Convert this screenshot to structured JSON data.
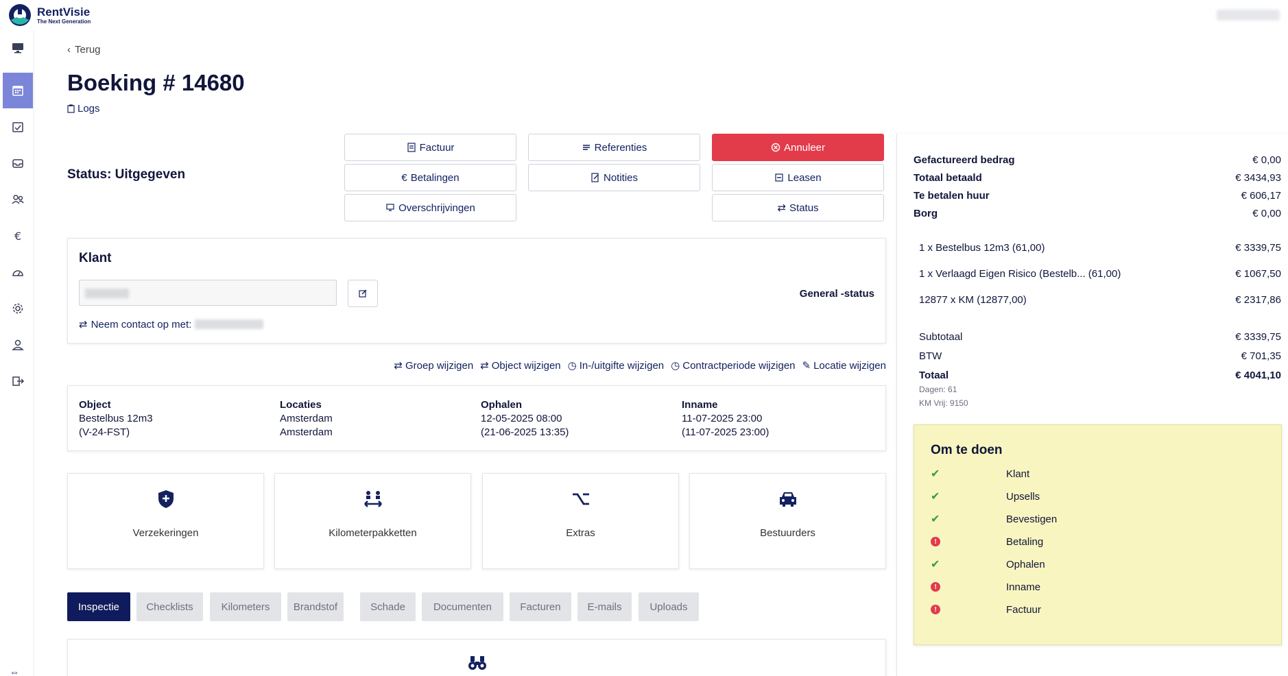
{
  "brand": {
    "name": "RentVisie",
    "tagline": "The Next Generation"
  },
  "colors": {
    "primary": "#0f1b5c",
    "danger": "#e23b4a",
    "sidebar_active": "#7b86d9",
    "todo_bg": "#f8f5c0",
    "ok": "#3a9a4a"
  },
  "sidebar": {
    "items": [
      {
        "icon": "monitor-icon"
      },
      {
        "icon": "calendar-icon",
        "active": true
      },
      {
        "icon": "calendar-check-icon"
      },
      {
        "icon": "inbox-icon"
      },
      {
        "icon": "users-icon"
      },
      {
        "icon": "euro-icon"
      },
      {
        "icon": "gauge-icon"
      },
      {
        "icon": "gear-icon"
      },
      {
        "icon": "user-icon"
      },
      {
        "icon": "logout-icon"
      }
    ]
  },
  "header": {
    "back": "Terug",
    "title": "Boeking # 14680",
    "logs": "Logs"
  },
  "status": "Status: Uitgegeven",
  "actions": {
    "factuur": "Factuur",
    "referenties": "Referenties",
    "annuleer": "Annuleer",
    "betalingen": "Betalingen",
    "notities": "Notities",
    "leasen": "Leasen",
    "overschrijvingen": "Overschrijvingen",
    "status": "Status"
  },
  "klant": {
    "title": "Klant",
    "general_status": "General -status",
    "contact": "Neem contact op met:"
  },
  "links": [
    "Groep wijzigen",
    "Object wijzigen",
    "In-/uitgifte wijzigen",
    "Contractperiode wijzigen",
    "Locatie wijzigen"
  ],
  "info": {
    "object": {
      "label": "Object",
      "line1": "Bestelbus 12m3",
      "line2": "(V-24-FST)"
    },
    "locaties": {
      "label": "Locaties",
      "line1": "Amsterdam",
      "line2": "Amsterdam"
    },
    "ophalen": {
      "label": "Ophalen",
      "line1": "12-05-2025 08:00",
      "line2": "(21-06-2025 13:35)"
    },
    "inname": {
      "label": "Inname",
      "line1": "11-07-2025 23:00",
      "line2": "(11-07-2025 23:00)"
    }
  },
  "tiles": [
    {
      "label": "Verzekeringen",
      "icon": "shield-plus-icon"
    },
    {
      "label": "Kilometerpakketten",
      "icon": "arrows-people-icon"
    },
    {
      "label": "Extras",
      "icon": "option-icon"
    },
    {
      "label": "Bestuurders",
      "icon": "car-icon"
    }
  ],
  "tabs": [
    "Inspectie",
    "Checklists",
    "Kilometers",
    "Brandstof",
    "Schade",
    "Documenten",
    "Facturen",
    "E-mails",
    "Uploads"
  ],
  "summary": {
    "gefactureerd": {
      "label": "Gefactureerd bedrag",
      "value": "€ 0,00"
    },
    "totaal_betaald": {
      "label": "Totaal betaald",
      "value": "€ 3434,93"
    },
    "te_betalen": {
      "label": "Te betalen huur",
      "value": "€ 606,17"
    },
    "borg": {
      "label": "Borg",
      "value": "€ 0,00"
    },
    "lines": [
      {
        "label": "1 x Bestelbus 12m3 (61,00)",
        "value": "€ 3339,75"
      },
      {
        "label": "1 x Verlaagd Eigen Risico (Bestelb... (61,00)",
        "value": "€ 1067,50"
      },
      {
        "label": "12877 x KM (12877,00)",
        "value": "€ 2317,86"
      }
    ],
    "subtotaal": {
      "label": "Subtotaal",
      "value": "€ 3339,75"
    },
    "btw": {
      "label": "BTW",
      "value": "€ 701,35"
    },
    "totaal": {
      "label": "Totaal",
      "value": "€ 4041,10"
    },
    "dagen": "Dagen: 61",
    "km_vrij": "KM Vrij: 9150"
  },
  "todo": {
    "title": "Om te doen",
    "items": [
      {
        "label": "Klant",
        "done": true
      },
      {
        "label": "Upsells",
        "done": true
      },
      {
        "label": "Bevestigen",
        "done": true
      },
      {
        "label": "Betaling",
        "done": false
      },
      {
        "label": "Ophalen",
        "done": true
      },
      {
        "label": "Inname",
        "done": false
      },
      {
        "label": "Factuur",
        "done": false
      }
    ]
  }
}
